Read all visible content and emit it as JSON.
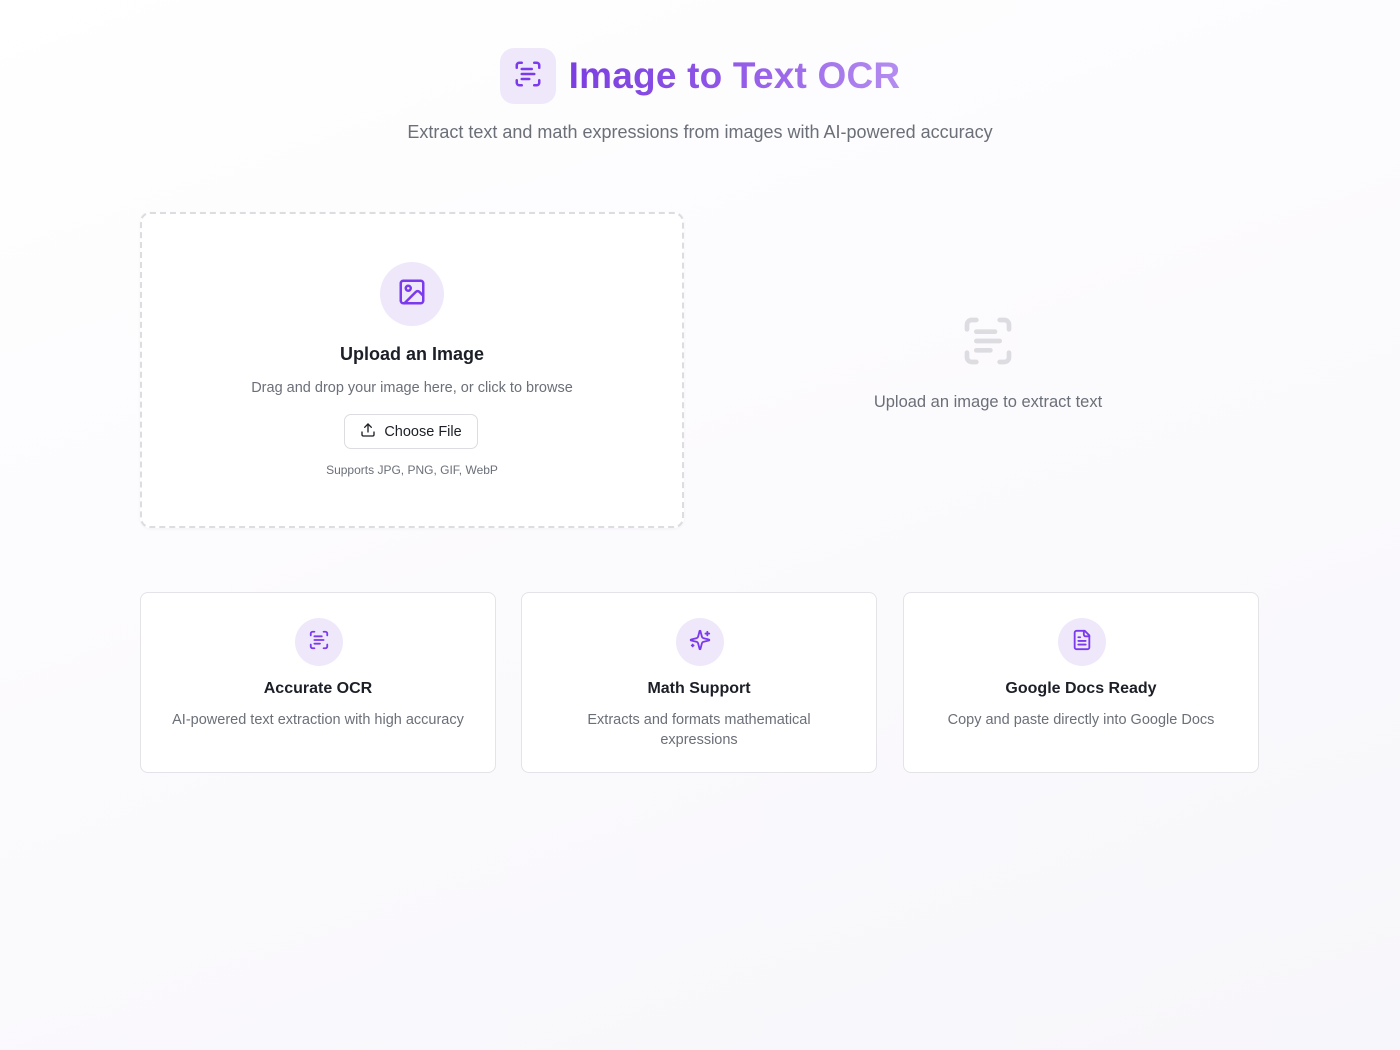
{
  "header": {
    "title": "Image to Text OCR",
    "subtitle": "Extract text and math expressions from images with AI-powered accuracy",
    "logo_icon": "scan-text-icon"
  },
  "upload": {
    "icon": "image-icon",
    "title": "Upload an Image",
    "description": "Drag and drop your image here, or click to browse",
    "button_label": "Choose File",
    "button_icon": "upload-icon",
    "supports": "Supports JPG, PNG, GIF, WebP"
  },
  "result": {
    "icon": "scan-text-icon",
    "placeholder": "Upload an image to extract text"
  },
  "features": [
    {
      "icon": "scan-text-icon",
      "title": "Accurate OCR",
      "description": "AI-powered text extraction with high accuracy"
    },
    {
      "icon": "sparkles-icon",
      "title": "Math Support",
      "description": "Extracts and formats mathematical expressions"
    },
    {
      "icon": "file-text-icon",
      "title": "Google Docs Ready",
      "description": "Copy and paste directly into Google Docs"
    }
  ],
  "colors": {
    "accent": "#7c3aed",
    "accent_light": "#efe8fb",
    "muted_text": "#6b6f78",
    "border": "#e3e3e8"
  }
}
